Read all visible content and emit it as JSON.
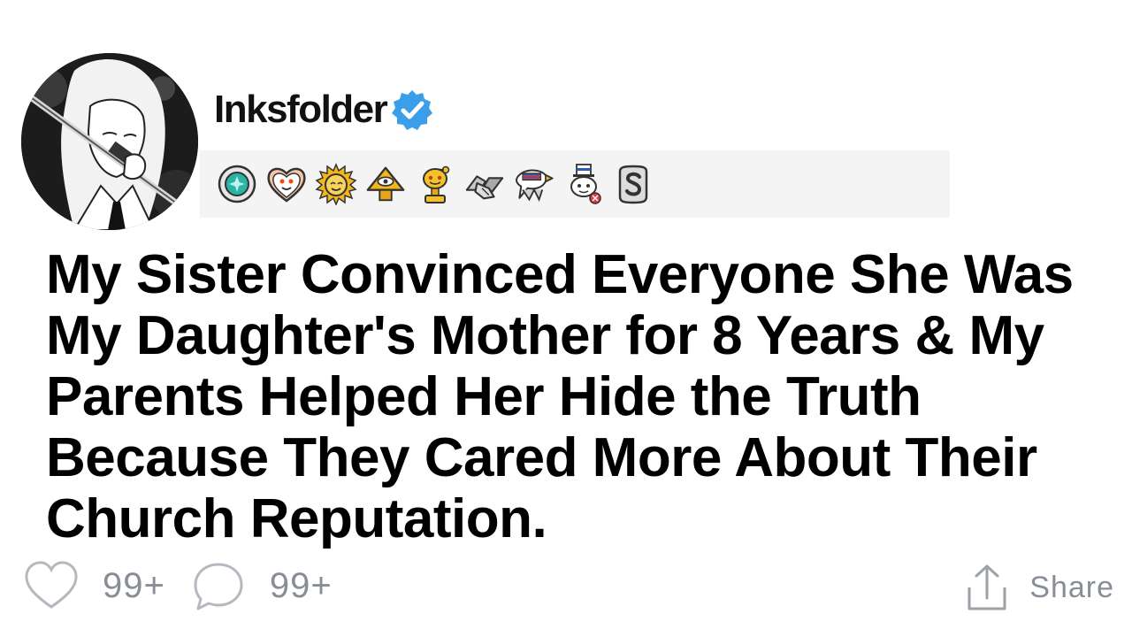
{
  "post": {
    "author": {
      "username": "Inksfolder",
      "verified": true,
      "verified_color": "#3a9ee8"
    },
    "badges": [
      {
        "icon": "teal-gem-award-icon"
      },
      {
        "icon": "heart-snoo-award-icon"
      },
      {
        "icon": "gold-sun-award-icon"
      },
      {
        "icon": "gold-pyramid-eye-award-icon"
      },
      {
        "icon": "gold-trophy-snoo-award-icon"
      },
      {
        "icon": "handshake-award-icon"
      },
      {
        "icon": "american-eagle-award-icon"
      },
      {
        "icon": "uncle-sam-snoo-award-icon"
      },
      {
        "icon": "silver-s-award-icon"
      }
    ],
    "title": "My Sister Convinced Everyone She Was My Daughter's Mother for 8 Years & My Parents Helped Her Hide the Truth Because They Cared More About Their Church Reputation.",
    "likes": "99+",
    "comments": "99+",
    "share_label": "Share",
    "muted_color": "#888d96"
  }
}
